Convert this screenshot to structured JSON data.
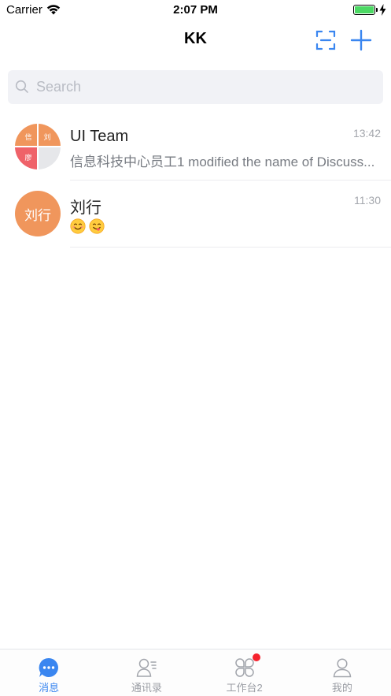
{
  "status_bar": {
    "carrier": "Carrier",
    "time": "2:07 PM",
    "battery_level": 1.0
  },
  "nav": {
    "title": "KK",
    "scan_icon": "scan-icon",
    "add_icon": "plus-icon"
  },
  "search": {
    "placeholder": "Search"
  },
  "conversations": [
    {
      "name": "UI Team",
      "time": "13:42",
      "preview": "信息科技中心员工1 modified the name of Discuss...",
      "avatar_type": "group",
      "avatar_chars": [
        "信",
        "刘",
        "廖"
      ]
    },
    {
      "name": "刘行",
      "time": "11:30",
      "avatar_type": "single",
      "avatar_text": "刘行",
      "preview_emojis": [
        "smiling-face-emoji",
        "face-savoring-food-emoji"
      ]
    }
  ],
  "tabs": [
    {
      "label": "消息",
      "icon": "chat-bubble-icon",
      "active": true
    },
    {
      "label": "通讯录",
      "icon": "contacts-icon",
      "active": false
    },
    {
      "label": "工作台2",
      "icon": "workbench-icon",
      "active": false,
      "badge": true
    },
    {
      "label": "我的",
      "icon": "profile-icon",
      "active": false
    }
  ],
  "colors": {
    "accent": "#3a86f0",
    "avatar_orange": "#f0965c",
    "avatar_red": "#ef6269",
    "badge_red": "#f5222d",
    "battery_green": "#4cd964"
  }
}
